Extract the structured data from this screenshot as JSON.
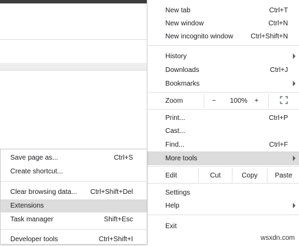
{
  "menu": {
    "new_tab": {
      "label": "New tab",
      "shortcut": "Ctrl+T"
    },
    "new_window": {
      "label": "New window",
      "shortcut": "Ctrl+N"
    },
    "new_incognito": {
      "label": "New incognito window",
      "shortcut": "Ctrl+Shift+N"
    },
    "history": {
      "label": "History"
    },
    "downloads": {
      "label": "Downloads",
      "shortcut": "Ctrl+J"
    },
    "bookmarks": {
      "label": "Bookmarks"
    },
    "zoom": {
      "label": "Zoom",
      "minus": "−",
      "level": "100%",
      "plus": "+"
    },
    "print": {
      "label": "Print...",
      "shortcut": "Ctrl+P"
    },
    "cast": {
      "label": "Cast..."
    },
    "find": {
      "label": "Find...",
      "shortcut": "Ctrl+F"
    },
    "more_tools": {
      "label": "More tools"
    },
    "edit": {
      "label": "Edit",
      "cut": "Cut",
      "copy": "Copy",
      "paste": "Paste"
    },
    "settings": {
      "label": "Settings"
    },
    "help": {
      "label": "Help"
    },
    "exit": {
      "label": "Exit"
    }
  },
  "submenu": {
    "save_page": {
      "label": "Save page as...",
      "shortcut": "Ctrl+S"
    },
    "create_shortcut": {
      "label": "Create shortcut..."
    },
    "clear_browsing": {
      "label": "Clear browsing data...",
      "shortcut": "Ctrl+Shift+Del"
    },
    "extensions": {
      "label": "Extensions"
    },
    "task_manager": {
      "label": "Task manager",
      "shortcut": "Shift+Esc"
    },
    "developer_tools": {
      "label": "Developer tools",
      "shortcut": "Ctrl+Shift+I"
    }
  },
  "watermark": "wsxdn.com",
  "colors": {
    "highlight": "#dcdcdc",
    "separator": "#e3e3e3",
    "text": "#202124"
  }
}
